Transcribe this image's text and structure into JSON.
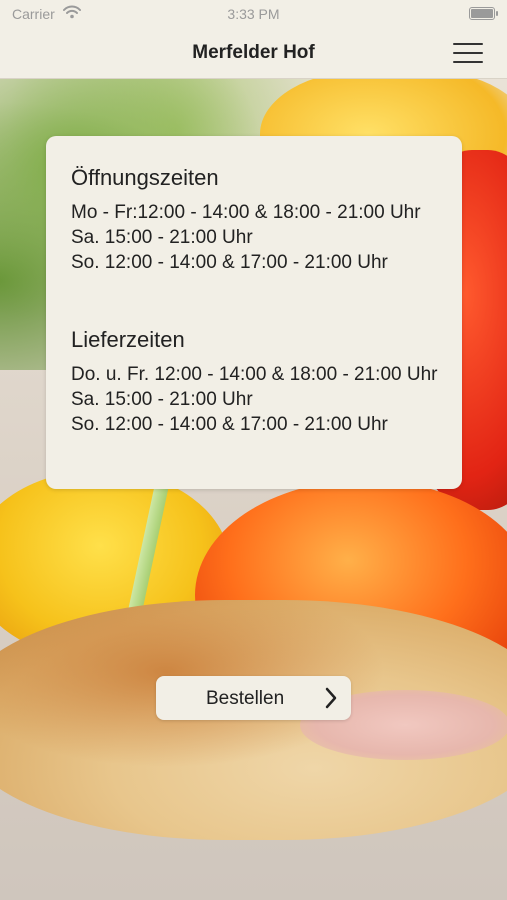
{
  "status_bar": {
    "carrier": "Carrier",
    "time": "3:33 PM"
  },
  "nav": {
    "title": "Merfelder Hof",
    "menu_icon": "hamburger-menu-icon"
  },
  "opening_hours": {
    "title": "Öffnungszeiten",
    "lines": [
      "Mo - Fr:12:00 - 14:00 & 18:00 - 21:00 Uhr",
      "Sa. 15:00 - 21:00 Uhr",
      "So. 12:00 - 14:00 & 17:00 - 21:00 Uhr"
    ]
  },
  "delivery_hours": {
    "title": "Lieferzeiten",
    "lines": [
      "Do. u. Fr. 12:00 - 14:00 & 18:00 - 21:00 Uhr",
      "Sa. 15:00 - 21:00 Uhr",
      "So. 12:00 - 14:00 & 17:00 - 21:00 Uhr"
    ]
  },
  "order_button": {
    "label": "Bestellen",
    "icon": "chevron-right-icon"
  },
  "colors": {
    "bar_background": "#f2efe6",
    "text": "#222222"
  }
}
